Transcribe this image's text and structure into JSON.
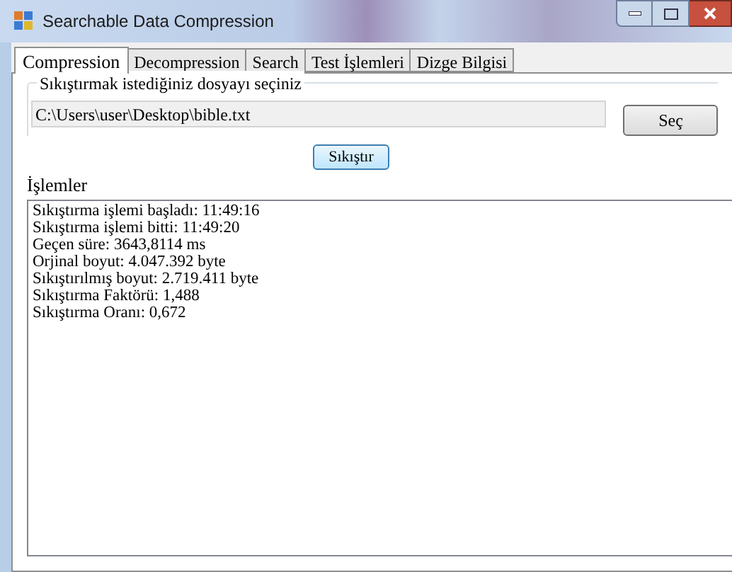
{
  "window": {
    "title": "Searchable Data Compression"
  },
  "tabs": [
    {
      "label": "Compression",
      "selected": true
    },
    {
      "label": "Decompression",
      "selected": false
    },
    {
      "label": "Search",
      "selected": false
    },
    {
      "label": "Test İşlemleri",
      "selected": false
    },
    {
      "label": "Dizge Bilgisi",
      "selected": false
    }
  ],
  "file_group": {
    "title": "Sıkıştırmak istediğiniz dosyayı seçiniz",
    "path": "C:\\Users\\user\\Desktop\\bible.txt",
    "browse_button": "Seç"
  },
  "compress_button": "Sıkıştır",
  "log": {
    "label": "İşlemler",
    "lines": [
      "Sıkıştırma işlemi başladı: 11:49:16",
      "Sıkıştırma işlemi bitti: 11:49:20",
      "Geçen süre: 3643,8114 ms",
      "Orjinal boyut: 4.047.392 byte",
      "Sıkıştırılmış boyut: 2.719.411 byte",
      "Sıkıştırma Faktörü: 1,488",
      "Sıkıştırma Oranı: 0,672"
    ]
  }
}
